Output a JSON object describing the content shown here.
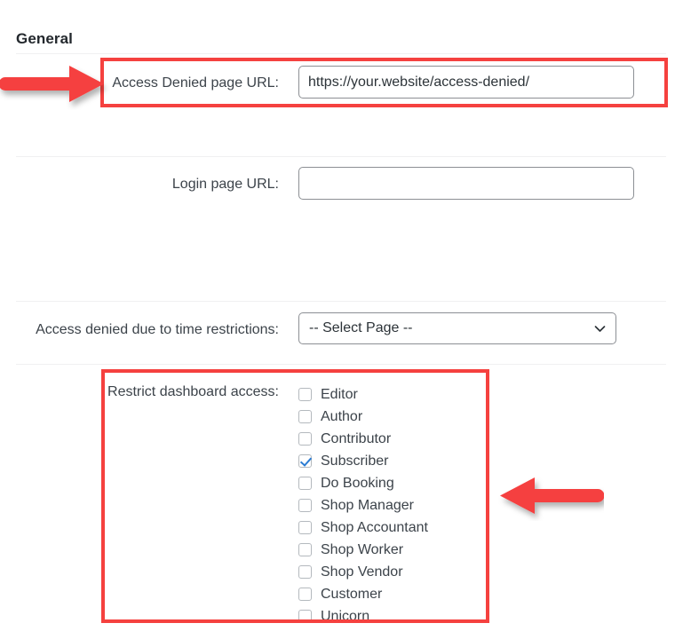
{
  "page": {
    "section_title": "General",
    "background": "#ffffff",
    "annotation_color": "#f5413f",
    "checkbox_accent": "#2b7cd3"
  },
  "fields": {
    "access_denied_url": {
      "label": "Access Denied page URL:",
      "value": "https://your.website/access-denied/",
      "placeholder": ""
    },
    "login_url": {
      "label": "Login page URL:",
      "value": "",
      "placeholder": ""
    },
    "time_restrictions": {
      "label": "Access denied due to time restrictions:",
      "selected": "-- Select Page --"
    },
    "restrict_dashboard": {
      "label": "Restrict dashboard access:",
      "roles": [
        {
          "label": "Editor",
          "checked": false
        },
        {
          "label": "Author",
          "checked": false
        },
        {
          "label": "Contributor",
          "checked": false
        },
        {
          "label": "Subscriber",
          "checked": true
        },
        {
          "label": "Do Booking",
          "checked": false
        },
        {
          "label": "Shop Manager",
          "checked": false
        },
        {
          "label": "Shop Accountant",
          "checked": false
        },
        {
          "label": "Shop Worker",
          "checked": false
        },
        {
          "label": "Shop Vendor",
          "checked": false
        },
        {
          "label": "Customer",
          "checked": false
        },
        {
          "label": "Unicorn",
          "checked": false
        }
      ]
    }
  },
  "annotations": {
    "highlight_boxes": [
      {
        "name": "access-denied-row-highlight"
      },
      {
        "name": "restrict-dashboard-highlight"
      }
    ],
    "arrows": [
      {
        "name": "arrow-pointing-right-at-access-denied",
        "direction": "right"
      },
      {
        "name": "arrow-pointing-left-at-roles",
        "direction": "left"
      }
    ]
  }
}
